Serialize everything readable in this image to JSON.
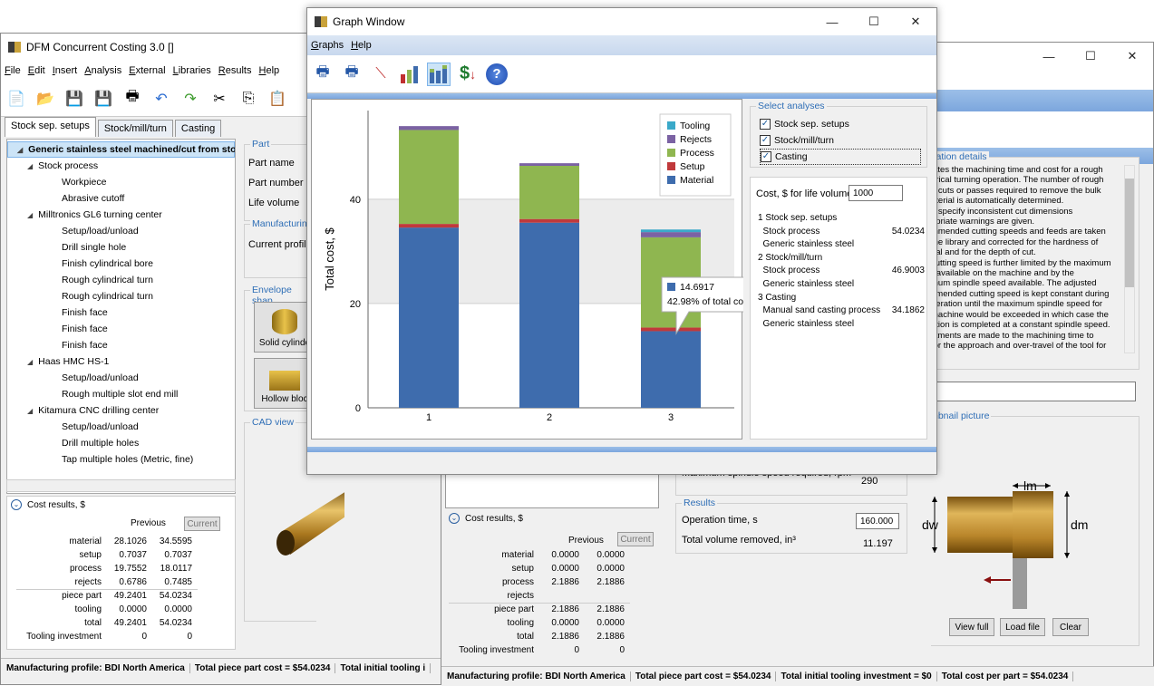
{
  "win1": {
    "title": "DFM Concurrent Costing 3.0 []",
    "menu": [
      "File",
      "Edit",
      "Insert",
      "Analysis",
      "External",
      "Libraries",
      "Results",
      "Help"
    ],
    "tabs": [
      "Stock sep. setups",
      "Stock/mill/turn",
      "Casting"
    ],
    "tree": [
      {
        "label": "Generic stainless steel machined/cut from stock",
        "level": 0,
        "selected": true
      },
      {
        "label": "Stock process",
        "level": 1
      },
      {
        "label": "Workpiece",
        "level": 2
      },
      {
        "label": "Abrasive cutoff",
        "level": 2
      },
      {
        "label": "Milltronics GL6 turning center",
        "level": 1
      },
      {
        "label": "Setup/load/unload",
        "level": 2
      },
      {
        "label": "Drill single hole",
        "level": 2
      },
      {
        "label": "Finish cylindrical bore",
        "level": 2
      },
      {
        "label": "Rough cylindrical turn",
        "level": 2
      },
      {
        "label": "Rough cylindrical turn",
        "level": 2
      },
      {
        "label": "Finish face",
        "level": 2
      },
      {
        "label": "Finish face",
        "level": 2
      },
      {
        "label": "Finish face",
        "level": 2
      },
      {
        "label": "Haas HMC HS-1",
        "level": 1
      },
      {
        "label": "Setup/load/unload",
        "level": 2
      },
      {
        "label": "Rough multiple slot end mill",
        "level": 2
      },
      {
        "label": "Kitamura CNC drilling center",
        "level": 1
      },
      {
        "label": "Setup/load/unload",
        "level": 2
      },
      {
        "label": "Drill multiple holes",
        "level": 2
      },
      {
        "label": "Tap multiple holes (Metric, fine)",
        "level": 2
      }
    ],
    "part_group": "Part",
    "part_fields": [
      "Part name",
      "Part number",
      "Life volume"
    ],
    "mfg_group": "Manufacturing",
    "mfg_fields": [
      "Current profile"
    ],
    "envelope_group": "Envelope shap",
    "env_buttons": [
      "Solid cylinde",
      "Hollow bloc"
    ],
    "cad_group": "CAD view",
    "cost": {
      "title": "Cost results, $",
      "prev": "Previous",
      "curr": "Current",
      "rows": [
        [
          "material",
          "28.1026",
          "34.5595"
        ],
        [
          "setup",
          "0.7037",
          "0.7037"
        ],
        [
          "process",
          "19.7552",
          "18.0117"
        ],
        [
          "rejects",
          "0.6786",
          "0.7485"
        ],
        [
          "piece part",
          "49.2401",
          "54.0234"
        ],
        [
          "tooling",
          "0.0000",
          "0.0000"
        ],
        [
          "total",
          "49.2401",
          "54.0234"
        ],
        [
          "Tooling investment",
          "0",
          "0"
        ]
      ]
    },
    "status": [
      "Manufacturing profile: BDI North America",
      "Total piece part cost = $54.0234",
      "Total initial tooling i"
    ]
  },
  "win2": {
    "op_group": "ration details",
    "op_text": [
      "lates the machining time and cost for a rough",
      "drical turning operation. The number of rough",
      "g cuts or passes required to remove the bulk",
      "aterial is automatically determined.",
      "u specify inconsistent cut dimensions",
      "opriate warnings are given.",
      "mmended cutting speeds and feeds are taken",
      "the library and corrected for the hardness of",
      "rial and for the depth of cut.",
      "cutting speed is further limited by the maximum",
      "r available on the machine and by the",
      "mum spindle speed available.  The adjusted",
      "nmended cutting speed is kept constant during",
      "peration until the maximum spindle speed for",
      "machine would be exceeded in which case the",
      "ation is completed at a constant spindle speed.",
      "stments are made to the machining time to",
      "for the approach and over-travel of the tool for"
    ],
    "thumb_group": "nbnail picture",
    "spindle_label": "Maximum spindle speed required, rpm",
    "spindle_val": "290",
    "results_group": "Results",
    "op_time_label": "Operation time, s",
    "op_time_val": "160.000",
    "vol_label": "Total volume removed, in³",
    "vol_val": "11.197",
    "thumb_labels": {
      "lm": "lm",
      "dw": "dw",
      "dm": "dm"
    },
    "buttons": [
      "View full",
      "Load file",
      "Clear"
    ],
    "cost": {
      "title": "Cost results, $",
      "prev": "Previous",
      "curr": "Current",
      "rows": [
        [
          "material",
          "0.0000",
          "0.0000"
        ],
        [
          "setup",
          "0.0000",
          "0.0000"
        ],
        [
          "process",
          "2.1886",
          "2.1886"
        ],
        [
          "rejects",
          "",
          ""
        ],
        [
          "piece part",
          "2.1886",
          "2.1886"
        ],
        [
          "tooling",
          "0.0000",
          "0.0000"
        ],
        [
          "total",
          "2.1886",
          "2.1886"
        ],
        [
          "Tooling investment",
          "0",
          "0"
        ]
      ]
    },
    "status": [
      "Manufacturing profile: BDI North America",
      "Total piece part cost = $54.0234",
      "Total initial tooling investment = $0",
      "Total cost per part = $54.0234"
    ]
  },
  "graph": {
    "title": "Graph Window",
    "menu": [
      "Graphs",
      "Help"
    ],
    "select_group": "Select analyses",
    "checks": [
      {
        "label": "Stock sep. setups",
        "checked": true
      },
      {
        "label": "Stock/mill/turn",
        "checked": true
      },
      {
        "label": "Casting",
        "checked": true
      }
    ],
    "cost_label": "Cost, $ for life volume",
    "cost_volume": "1000",
    "summary": [
      {
        "t": "1 Stock sep. setups",
        "v": ""
      },
      {
        "t": "  Stock process",
        "v": "54.0234"
      },
      {
        "t": "  Generic stainless steel",
        "v": ""
      },
      {
        "t": "2 Stock/mill/turn",
        "v": ""
      },
      {
        "t": "  Stock process",
        "v": "46.9003"
      },
      {
        "t": "  Generic stainless steel",
        "v": ""
      },
      {
        "t": "3 Casting",
        "v": ""
      },
      {
        "t": "  Manual sand casting process",
        "v": "34.1862"
      },
      {
        "t": "  Generic stainless steel",
        "v": ""
      }
    ],
    "tooltip": {
      "value": "14.6917",
      "pct": "42.98% of total cost"
    }
  },
  "colors": {
    "material": "#3e6cad",
    "setup": "#c0393b",
    "process": "#8fb650",
    "rejects": "#7b62a3",
    "tooling": "#3aa9c9"
  },
  "chart_data": {
    "type": "bar",
    "stacked": true,
    "categories": [
      "1",
      "2",
      "3"
    ],
    "ylabel": "Total cost, $",
    "ylim": [
      0,
      57
    ],
    "yticks": [
      0,
      20,
      40
    ],
    "series": [
      {
        "name": "Material",
        "values": [
          34.56,
          35.5,
          14.69
        ]
      },
      {
        "name": "Setup",
        "values": [
          0.7,
          0.7,
          0.7
        ]
      },
      {
        "name": "Process",
        "values": [
          18.01,
          10.2,
          17.3
        ]
      },
      {
        "name": "Rejects",
        "values": [
          0.75,
          0.5,
          1.0
        ]
      },
      {
        "name": "Tooling",
        "values": [
          0,
          0,
          0.5
        ]
      }
    ],
    "legend_position": "top-right"
  }
}
